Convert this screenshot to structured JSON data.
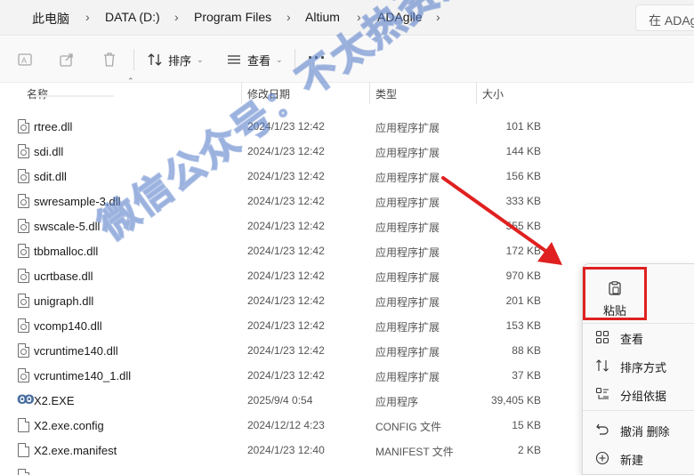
{
  "address": {
    "crumbs": [
      "此电脑",
      "DATA (D:)",
      "Program Files",
      "Altium",
      "ADAgile"
    ],
    "search_placeholder": "在 ADAg"
  },
  "toolbar": {
    "sort_label": "排序",
    "view_label": "查看",
    "more_label": "···"
  },
  "columns": {
    "name": "名称",
    "date": "修改日期",
    "type": "类型",
    "size": "大小"
  },
  "files": [
    {
      "name": "rtree.dll",
      "date": "2024/1/23 12:42",
      "type": "应用程序扩展",
      "size": "101 KB"
    },
    {
      "name": "sdi.dll",
      "date": "2024/1/23 12:42",
      "type": "应用程序扩展",
      "size": "144 KB"
    },
    {
      "name": "sdit.dll",
      "date": "2024/1/23 12:42",
      "type": "应用程序扩展",
      "size": "156 KB"
    },
    {
      "name": "swresample-3.dll",
      "date": "2024/1/23 12:42",
      "type": "应用程序扩展",
      "size": "333 KB"
    },
    {
      "name": "swscale-5.dll",
      "date": "2024/1/23 12:42",
      "type": "应用程序扩展",
      "size": "555 KB"
    },
    {
      "name": "tbbmalloc.dll",
      "date": "2024/1/23 12:42",
      "type": "应用程序扩展",
      "size": "172 KB"
    },
    {
      "name": "ucrtbase.dll",
      "date": "2024/1/23 12:42",
      "type": "应用程序扩展",
      "size": "970 KB"
    },
    {
      "name": "unigraph.dll",
      "date": "2024/1/23 12:42",
      "type": "应用程序扩展",
      "size": "201 KB"
    },
    {
      "name": "vcomp140.dll",
      "date": "2024/1/23 12:42",
      "type": "应用程序扩展",
      "size": "153 KB"
    },
    {
      "name": "vcruntime140.dll",
      "date": "2024/1/23 12:42",
      "type": "应用程序扩展",
      "size": "88 KB"
    },
    {
      "name": "vcruntime140_1.dll",
      "date": "2024/1/23 12:42",
      "type": "应用程序扩展",
      "size": "37 KB"
    },
    {
      "name": "X2.EXE",
      "date": "2025/9/4 0:54",
      "type": "应用程序",
      "size": "39,405 KB"
    },
    {
      "name": "X2.exe.config",
      "date": "2024/12/12 4:23",
      "type": "CONFIG 文件",
      "size": "15 KB"
    },
    {
      "name": "X2.exe.manifest",
      "date": "2024/1/23 12:40",
      "type": "MANIFEST 文件",
      "size": "2 KB"
    }
  ],
  "context_menu": {
    "paste_label": "粘贴",
    "view_label": "查看",
    "sort_label": "排序方式",
    "group_label": "分组依据",
    "undo_label": "撤消 删除",
    "new_label": "新建"
  },
  "watermark": "微信公众号：不太热资源库",
  "colors": {
    "highlight": "#e02020",
    "arrow": "#e02020"
  }
}
